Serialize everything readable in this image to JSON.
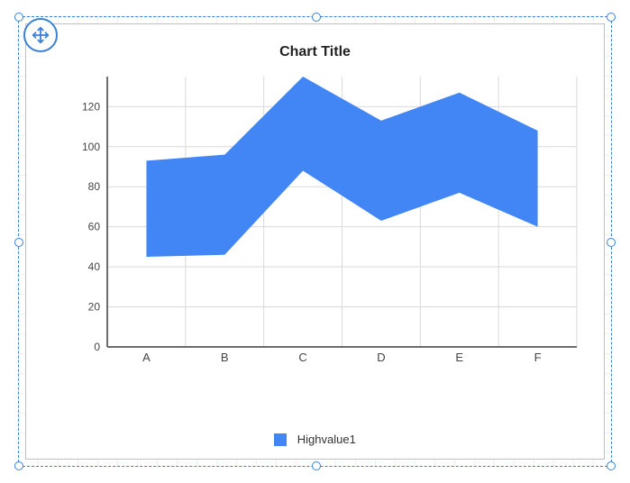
{
  "selection": {
    "move_icon_name": "move-icon"
  },
  "chart": {
    "title": "Chart Title",
    "legend": {
      "series_label": "Highvalue1",
      "swatch_color": "#4285f4"
    },
    "colors": {
      "series": "#4285f4",
      "grid": "#d9d9d9",
      "axis": "#6b6b6b"
    }
  },
  "chart_data": {
    "type": "area",
    "title": "Chart Title",
    "xlabel": "",
    "ylabel": "",
    "categories": [
      "A",
      "B",
      "C",
      "D",
      "E",
      "F"
    ],
    "series": [
      {
        "name": "Highvalue1",
        "high": [
          93,
          96,
          135,
          113,
          127,
          108
        ],
        "low": [
          45,
          46,
          88,
          63,
          77,
          60
        ]
      }
    ],
    "yticks": [
      0,
      20,
      40,
      60,
      80,
      100,
      120
    ],
    "ylim": [
      0,
      135
    ]
  }
}
